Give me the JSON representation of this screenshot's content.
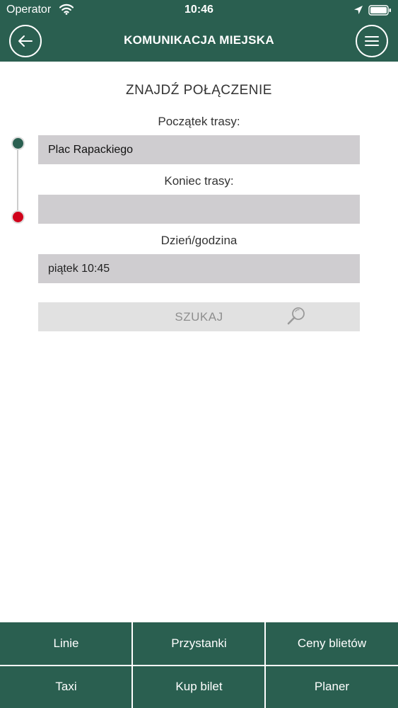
{
  "status_bar": {
    "carrier": "Operator",
    "time": "10:46",
    "icons": [
      "wifi-icon",
      "location-arrow-icon",
      "battery-icon"
    ]
  },
  "header": {
    "title": "KOMUNIKACJA MIEJSKA",
    "back_icon": "arrow-left-icon",
    "menu_icon": "hamburger-menu-icon"
  },
  "form": {
    "heading": "ZNAJDŹ POŁĄCZENIE",
    "start_label": "Początek trasy:",
    "start_value": "Plac Rapackiego",
    "end_label": "Koniec trasy:",
    "end_value": "",
    "datetime_label": "Dzień/godzina",
    "datetime_value": "piątek 10:45",
    "search_label": "SZUKAJ",
    "search_icon": "magnifier-icon"
  },
  "bottom_nav": {
    "items": [
      "Linie",
      "Przystanki",
      "Ceny blietów",
      "Taxi",
      "Kup bilet",
      "Planer"
    ]
  },
  "colors": {
    "primary": "#2a5f50",
    "start_marker": "#2a5f50",
    "end_marker": "#d0021b",
    "field_bg": "#cfcdd0",
    "button_bg": "#e1e1e1"
  }
}
